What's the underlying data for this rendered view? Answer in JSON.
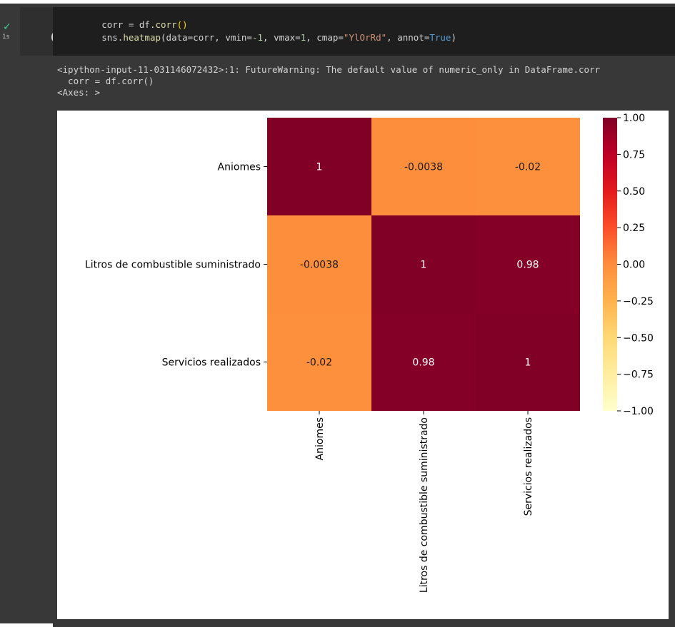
{
  "run": {
    "status_icon": "check-icon",
    "time": "1s"
  },
  "code": {
    "line1": {
      "a": "corr = df.",
      "b": "corr",
      "c": "()"
    },
    "line2": {
      "p1": "sns.",
      "p2": "heatmap",
      "p3": "(data=corr, vmin=",
      "p4": "-1",
      "p5": ", vmax=",
      "p6": "1",
      "p7": ", cmap=",
      "p8": "\"YlOrRd\"",
      "p9": ", annot=",
      "p10": "True",
      "p11": ")"
    }
  },
  "output": {
    "warning_line": "<ipython-input-11-031146072432>:1: FutureWarning: The default value of numeric_only in DataFrame.corr",
    "warning_code": "  corr = df.corr()",
    "axes_repr": "<Axes: >"
  },
  "chart_data": {
    "type": "heatmap",
    "rows": [
      "Aniomes",
      "Litros de combustible suministrado",
      "Servicios realizados"
    ],
    "cols": [
      "Aniomes",
      "Litros de combustible suministrado",
      "Servicios realizados"
    ],
    "values": [
      [
        1,
        -0.0038,
        -0.02
      ],
      [
        -0.0038,
        1,
        0.98
      ],
      [
        -0.02,
        0.98,
        1
      ]
    ],
    "annotations": [
      [
        "1",
        "-0.0038",
        "-0.02"
      ],
      [
        "-0.0038",
        "1",
        "0.98"
      ],
      [
        "-0.02",
        "0.98",
        "1"
      ]
    ],
    "vmin": -1,
    "vmax": 1,
    "cmap": "YlOrRd",
    "colorbar_ticks": [
      "1.00",
      "0.75",
      "0.50",
      "0.25",
      "0.00",
      "−0.25",
      "−0.50",
      "−0.75",
      "−1.00"
    ]
  }
}
